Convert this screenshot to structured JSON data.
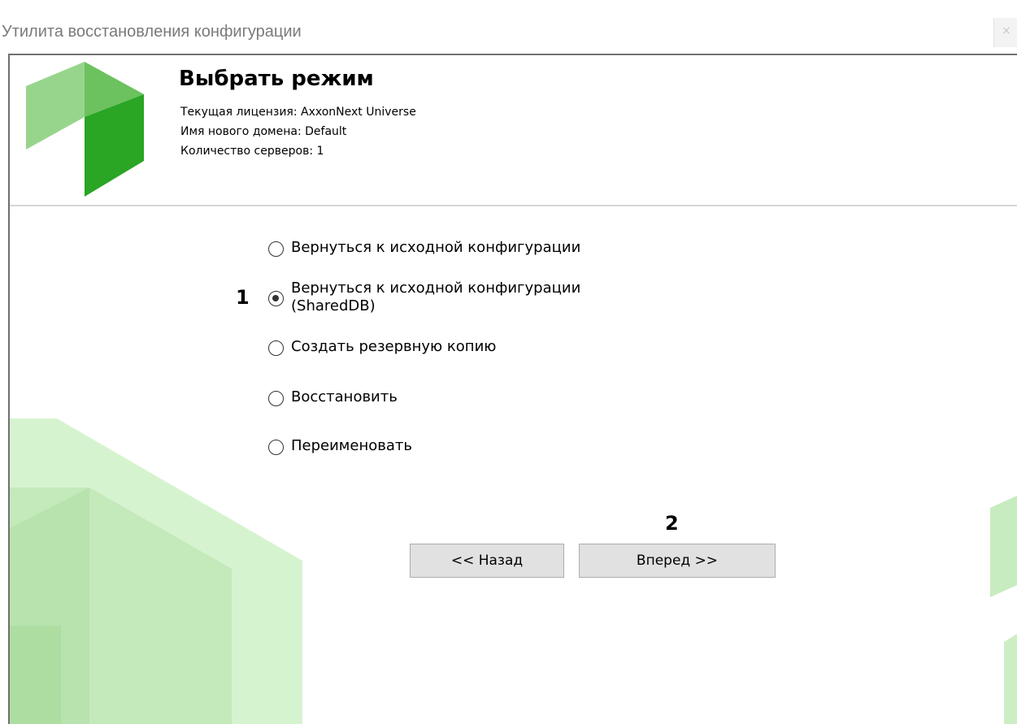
{
  "window": {
    "title": "Утилита восстановления конфигурации",
    "close_label": "×"
  },
  "header": {
    "title": "Выбрать режим",
    "license_line": "Текущая лицензия: AxxonNext Universe",
    "domain_line": "Имя нового домена: Default",
    "servers_line": "Количество серверов: 1"
  },
  "options": [
    {
      "label": "Вернуться к исходной конфигурации",
      "checked": false
    },
    {
      "label_line1": "Вернуться к исходной конфигурации",
      "label_line2": "(SharedDB)",
      "checked": true
    },
    {
      "label": "Создать резервную копию",
      "checked": false
    },
    {
      "label": "Восстановить",
      "checked": false
    },
    {
      "label": "Переименовать",
      "checked": false
    }
  ],
  "annotations": {
    "marker_1": "1",
    "marker_2": "2"
  },
  "buttons": {
    "back": "<< Назад",
    "next": "Вперед >>"
  },
  "colors": {
    "logo_dark": "#2ea52a",
    "logo_mid": "#6cc25e",
    "logo_light": "#94d48a",
    "decor_green": "#c9edc2"
  }
}
